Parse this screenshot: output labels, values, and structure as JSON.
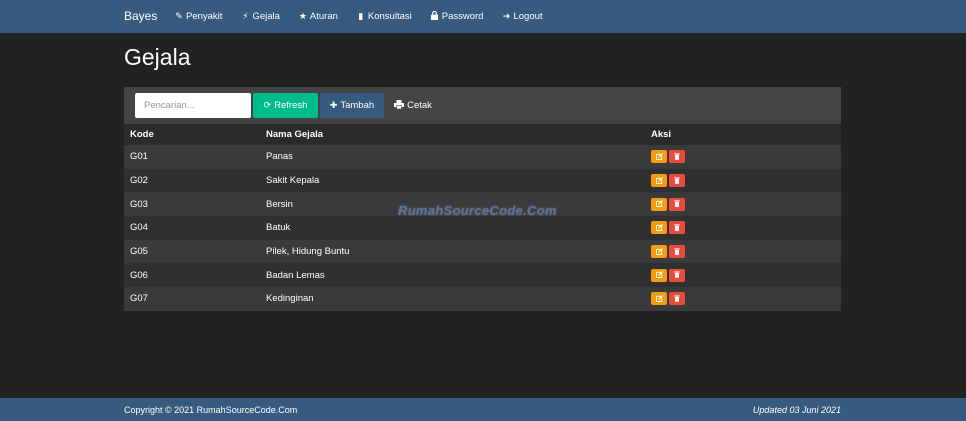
{
  "nav": {
    "brand": "Bayes",
    "items": [
      {
        "label": "Penyakit",
        "icon": "pin-icon",
        "glyph": "✎"
      },
      {
        "label": "Gejala",
        "icon": "bolt-icon",
        "glyph": "⚡"
      },
      {
        "label": "Aturan",
        "icon": "star-icon",
        "glyph": "★"
      },
      {
        "label": "Konsultasi",
        "icon": "bar-chart-icon",
        "glyph": "▮"
      },
      {
        "label": "Password",
        "icon": "lock-icon",
        "glyph": "🔒"
      },
      {
        "label": "Logout",
        "icon": "logout-icon",
        "glyph": "➜"
      }
    ]
  },
  "page": {
    "title": "Gejala"
  },
  "toolbar": {
    "search_placeholder": "Pencarian...",
    "refresh_label": "Refresh",
    "tambah_label": "Tambah",
    "cetak_label": "Cetak"
  },
  "table": {
    "headers": [
      "Kode",
      "Nama Gejala",
      "Aksi"
    ],
    "rows": [
      {
        "kode": "G01",
        "nama": "Panas"
      },
      {
        "kode": "G02",
        "nama": "Sakit Kepala"
      },
      {
        "kode": "G03",
        "nama": "Bersin"
      },
      {
        "kode": "G04",
        "nama": "Batuk"
      },
      {
        "kode": "G05",
        "nama": "Pilek, Hidung Buntu"
      },
      {
        "kode": "G06",
        "nama": "Badan Lemas"
      },
      {
        "kode": "G07",
        "nama": "Kedinginan"
      }
    ]
  },
  "watermark": "RumahSourceCode.Com",
  "footer": {
    "copyright": "Copyright © 2021 RumahSourceCode.Com",
    "updated": "Updated 03 Juni 2021"
  },
  "colors": {
    "navbar": "#375a7f",
    "background": "#222222",
    "success": "#00bc8c",
    "warning": "#f39c12",
    "danger": "#e74c3c"
  }
}
